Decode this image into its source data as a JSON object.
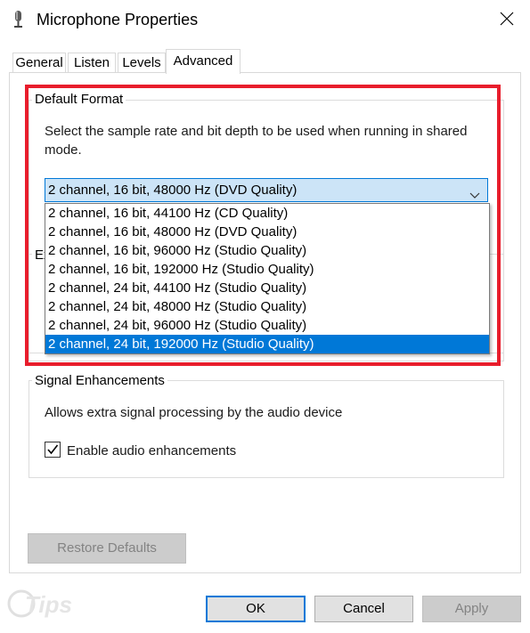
{
  "window": {
    "title": "Microphone Properties",
    "close_glyph": "✕"
  },
  "tabs": [
    {
      "label": "General",
      "active": false
    },
    {
      "label": "Listen",
      "active": false
    },
    {
      "label": "Levels",
      "active": false
    },
    {
      "label": "Advanced",
      "active": true
    }
  ],
  "default_format": {
    "title": "Default Format",
    "description": "Select the sample rate and bit depth to be used when running in shared mode.",
    "selected_value": "2 channel, 16 bit, 48000 Hz (DVD Quality)",
    "options": [
      "2 channel, 16 bit, 44100 Hz (CD Quality)",
      "2 channel, 16 bit, 48000 Hz (DVD Quality)",
      "2 channel, 16 bit, 96000 Hz (Studio Quality)",
      "2 channel, 16 bit, 192000 Hz (Studio Quality)",
      "2 channel, 24 bit, 44100 Hz (Studio Quality)",
      "2 channel, 24 bit, 48000 Hz (Studio Quality)",
      "2 channel, 24 bit, 96000 Hz (Studio Quality)",
      "2 channel, 24 bit, 192000 Hz (Studio Quality)"
    ],
    "highlighted_option_index": 7
  },
  "exclusive_mode": {
    "title_partial": "Ex"
  },
  "signal_enhancements": {
    "title": "Signal Enhancements",
    "description": "Allows extra signal processing by the audio device",
    "checkbox_label": "Enable audio enhancements",
    "checked": true
  },
  "buttons": {
    "restore_defaults": "Restore Defaults",
    "ok": "OK",
    "cancel": "Cancel",
    "apply": "Apply"
  },
  "watermark": {
    "text": "Tips"
  },
  "colors": {
    "highlight_red": "#e81d2c",
    "selection_blue": "#0078d7",
    "select_bg": "#cce4f7"
  }
}
